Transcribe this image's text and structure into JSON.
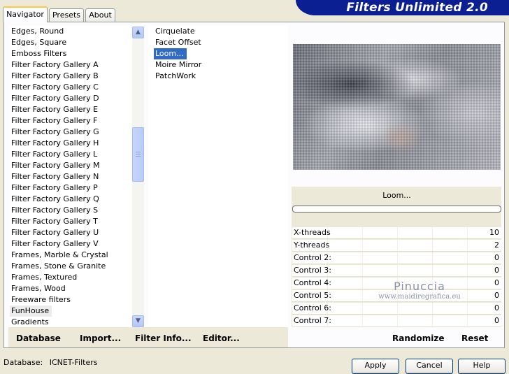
{
  "tabs": [
    {
      "label": "Navigator",
      "active": true
    },
    {
      "label": "Presets",
      "active": false
    },
    {
      "label": "About",
      "active": false
    }
  ],
  "banner": {
    "title": "Filters Unlimited 2.0"
  },
  "categories": [
    "Edges, Round",
    "Edges, Square",
    "Emboss Filters",
    "Filter Factory Gallery A",
    "Filter Factory Gallery B",
    "Filter Factory Gallery C",
    "Filter Factory Gallery D",
    "Filter Factory Gallery E",
    "Filter Factory Gallery F",
    "Filter Factory Gallery G",
    "Filter Factory Gallery H",
    "Filter Factory Gallery L",
    "Filter Factory Gallery M",
    "Filter Factory Gallery N",
    "Filter Factory Gallery P",
    "Filter Factory Gallery Q",
    "Filter Factory Gallery S",
    "Filter Factory Gallery T",
    "Filter Factory Gallery U",
    "Filter Factory Gallery V",
    "Frames, Marble & Crystal",
    "Frames, Stone & Granite",
    "Frames, Textured",
    "Frames, Wood",
    "Freeware filters",
    "FunHouse",
    "Gradients"
  ],
  "highlighted_category": "FunHouse",
  "filters": [
    "Cirquelate",
    "Facet Offset",
    "Loom...",
    "Moire Mirror",
    "PatchWork"
  ],
  "selected_filter": "Loom...",
  "filter_title": "Loom...",
  "controls": [
    {
      "label": "X-threads",
      "value": "10"
    },
    {
      "label": "Y-threads",
      "value": "2"
    },
    {
      "label": "Control 2:",
      "value": "0"
    },
    {
      "label": "Control 3:",
      "value": "0"
    },
    {
      "label": "Control 4:",
      "value": "0"
    },
    {
      "label": "Control 5:",
      "value": "0"
    },
    {
      "label": "Control 6:",
      "value": "0"
    },
    {
      "label": "Control 7:",
      "value": "0"
    }
  ],
  "watermark": {
    "line1": "Pinuccia",
    "line2": "www.maidiregrafica.eu"
  },
  "bottom_buttons": {
    "database": "Database",
    "import": "Import...",
    "filter_info": "Filter Info...",
    "editor": "Editor...",
    "randomize": "Randomize",
    "reset": "Reset"
  },
  "status": {
    "label": "Database:",
    "value": "ICNET-Filters"
  },
  "dialog_buttons": {
    "apply": "Apply",
    "cancel": "Cancel",
    "help": "Help"
  }
}
